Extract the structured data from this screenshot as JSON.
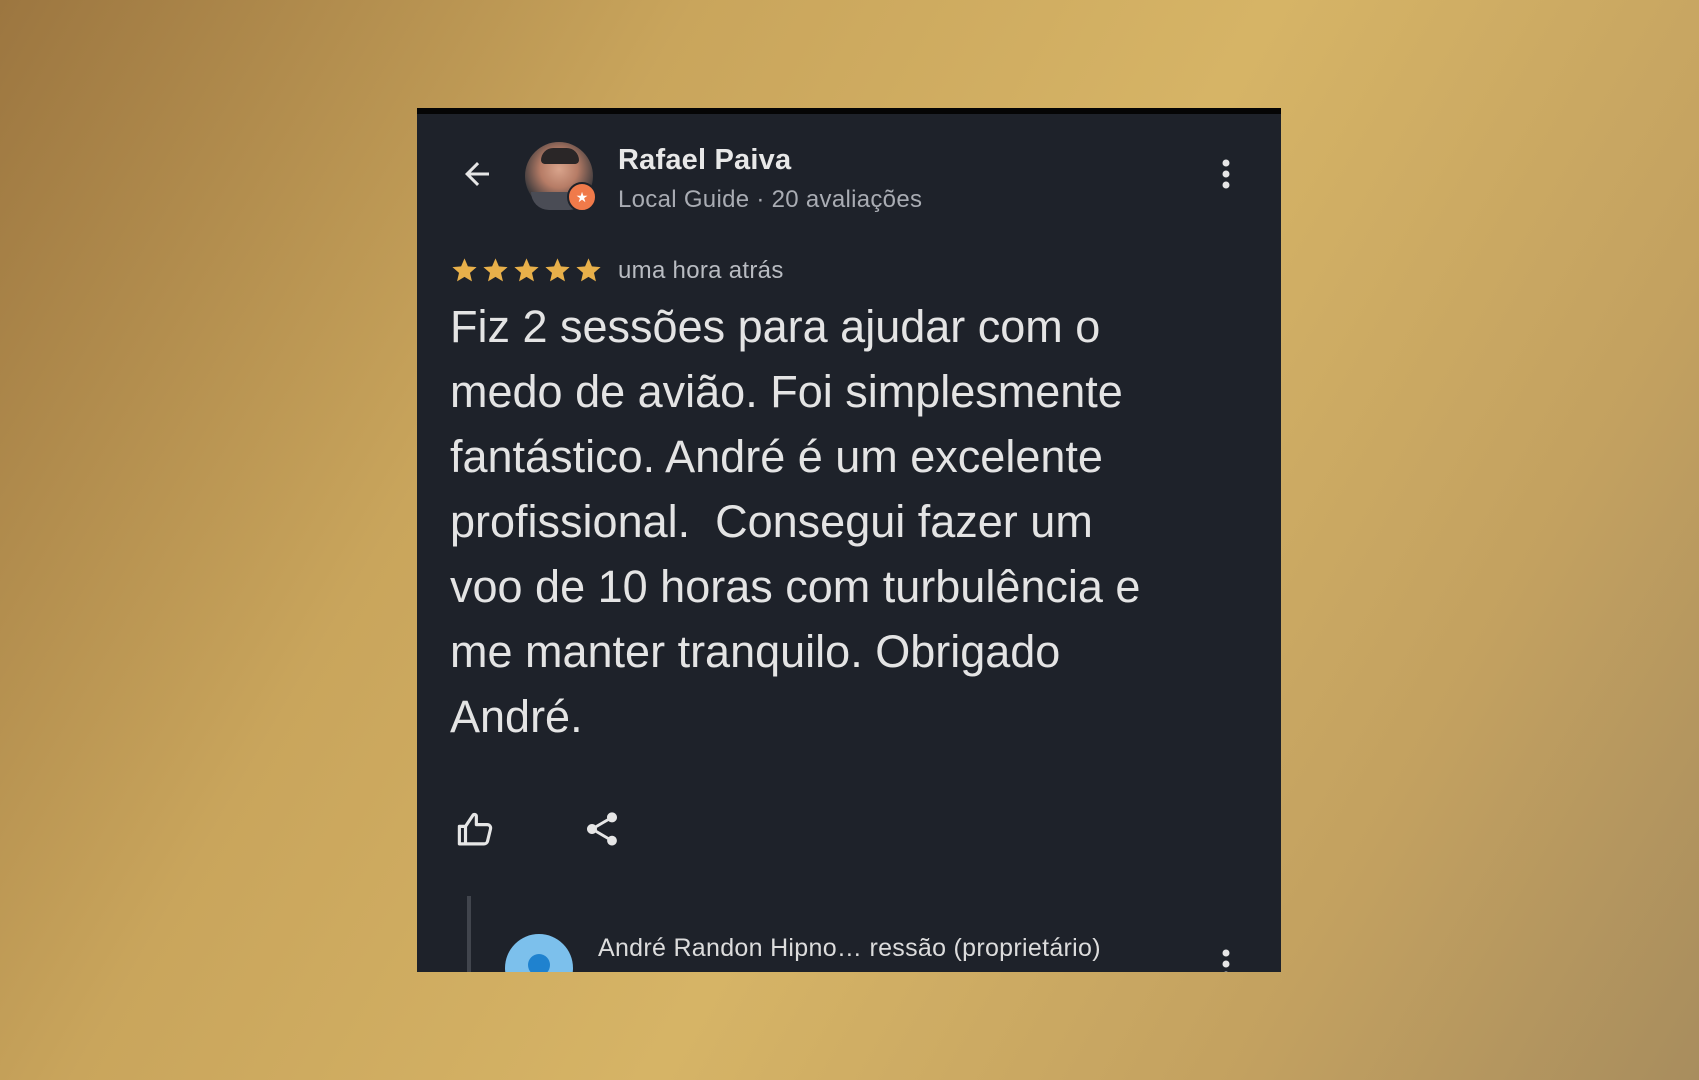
{
  "colors": {
    "card_background": "#1e222a",
    "star": "#e8b04a",
    "badge": "#f07a4a",
    "owner_avatar": "#7cc0ec"
  },
  "header": {
    "back_icon": "arrow-left-icon",
    "reviewer_name": "Rafael Paiva",
    "reviewer_subtitle": "Local Guide · 20 avaliações",
    "menu_icon": "more-vertical-icon"
  },
  "review": {
    "rating": 5,
    "rating_max": 5,
    "time": "uma hora atrás",
    "text": "Fiz 2 sessões para ajudar com o\nmedo de avião. Foi simplesmente\nfantástico. André é um excelente\nprofissional.  Consegui fazer um\nvoo de 10 horas com turbulência e\nme manter tranquilo. Obrigado\nAndré."
  },
  "actions": {
    "like_icon": "thumbs-up-icon",
    "share_icon": "share-icon"
  },
  "owner_reply": {
    "name": "André Randon Hipno…  ressão (proprietário)",
    "menu_icon": "more-vertical-icon"
  }
}
